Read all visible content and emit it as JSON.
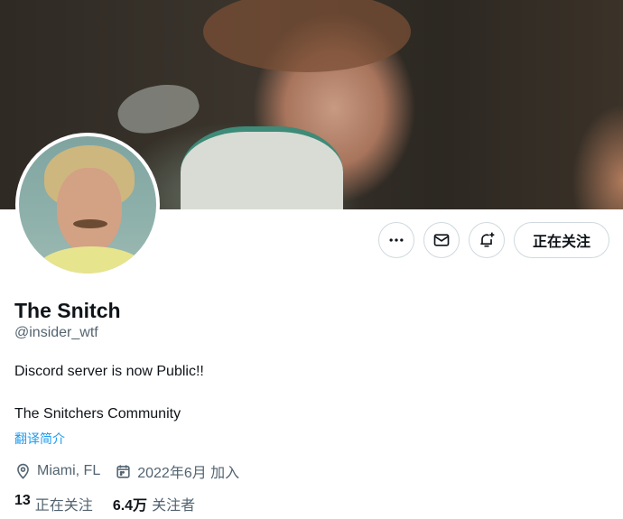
{
  "profile": {
    "display_name": "The Snitch",
    "handle": "@insider_wtf",
    "bio_line1": "Discord server is now Public!!",
    "bio_line2": "The Snitchers Community",
    "translate_link": "翻译简介",
    "location": "Miami, FL",
    "joined": "2022年6月 加入"
  },
  "actions": {
    "more_icon": "more-horizontal-icon",
    "message_icon": "mail-icon",
    "notify_icon": "bell-plus-icon",
    "follow_label": "正在关注"
  },
  "stats": {
    "following_count": "13",
    "following_label": "正在关注",
    "followers_count": "6.4万",
    "followers_label": "关注者"
  },
  "colors": {
    "link": "#1d9bf0",
    "secondary_text": "#536471",
    "border": "#cfd9de"
  }
}
